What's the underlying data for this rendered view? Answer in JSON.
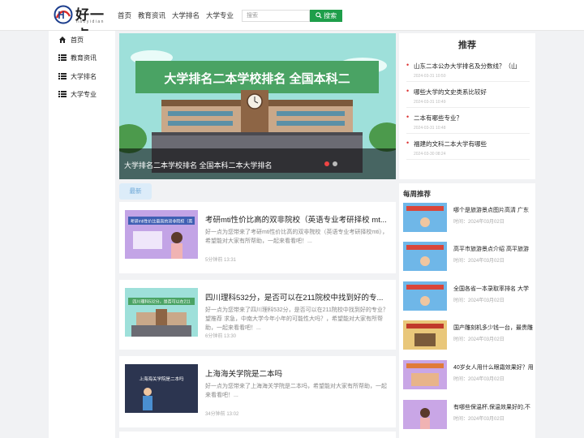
{
  "site": {
    "logo_text": "好一点",
    "logo_sub": "haoyidian"
  },
  "nav": [
    "首页",
    "教育资讯",
    "大学排名",
    "大学专业"
  ],
  "search": {
    "placeholder": "搜索",
    "button": "搜索"
  },
  "sidebar": [
    {
      "label": "首页",
      "icon": "home-icon"
    },
    {
      "label": "教育资讯",
      "icon": "list-icon"
    },
    {
      "label": "大学排名",
      "icon": "list-icon"
    },
    {
      "label": "大学专业",
      "icon": "list-icon"
    }
  ],
  "slider": {
    "banner_text": "大学排名二本学校排名 全国本科二",
    "caption": "大学排名二本学校排名 全国本科二本大学排名"
  },
  "tab_latest": "最新",
  "articles": [
    {
      "thumb_text": "考研mti性价比最高的双非院校（英",
      "title": "考研mti性价比高的双非院校（英语专业考研择校 mt...",
      "desc": "好一点为您带来了考研mti性价比高的双非院校（英语专业考研择校mti），希望能对大家有所帮助，一起来看看吧！...",
      "time": "5分钟前 13:31"
    },
    {
      "thumb_text": "四川理科532分，是否可以在211",
      "title": "四川理科532分，是否可以在211院校中找到好的专...",
      "desc": "好一点为您带来了四川理科532分，是否可以在211院校中找到好的专业？望推荐 求急，中南大学今年小年的可能性大吗？，希望能对大家有所帮助，一起来看看吧！...",
      "time": "6分钟前 13:30"
    },
    {
      "thumb_text": "上海海关学院是二本吗",
      "title": "上海海关学院是二本吗",
      "desc": "好一点为您带来了上海海关学院是二本吗，希望能对大家有所帮助，一起来看看吧！...",
      "time": "34分钟前 13:02"
    }
  ],
  "recommend": {
    "title": "推荐",
    "items": [
      {
        "title": "山东二本公办大学排名及分数线？（山",
        "date": "2024-03-31 10:50"
      },
      {
        "title": "哪些大学的文史类系比较好",
        "date": "2024-03-31 10:49"
      },
      {
        "title": "二本有哪些专业？",
        "date": "2024-03-31 10:48"
      },
      {
        "title": "福建的文科二本大学有哪些",
        "date": "2024-03-30 08:24"
      }
    ]
  },
  "weekly": {
    "title": "每周推荐",
    "items": [
      {
        "title": "哪个是旅游景点图片高清 广东",
        "date": "时间：2024年03月02日",
        "color": "#6fb7e8"
      },
      {
        "title": "高平市旅游景点介绍 高平旅游",
        "date": "时间：2024年03月02日",
        "color": "#6fb7e8"
      },
      {
        "title": "全国各省一本录取率排名 大学",
        "date": "时间：2024年03月02日",
        "color": "#6fb7e8"
      },
      {
        "title": "国产雕刻机多少钱一台，最贵雕",
        "date": "时间：2024年03月02日",
        "color": "#e9c77a"
      },
      {
        "title": "40岁女人用什么眼霜效果好？用",
        "date": "时间：2024年03月02日",
        "color": "#c9a6e6"
      },
      {
        "title": "有哪些保温杯,保温效果好的,不",
        "date": "时间：2024年03月02日",
        "color": "#c9a6e6"
      }
    ]
  }
}
